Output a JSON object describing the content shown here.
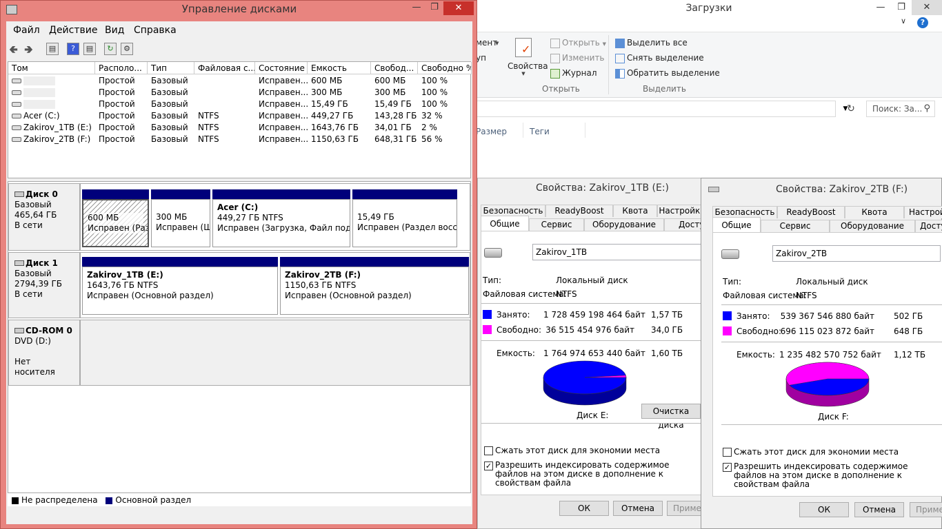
{
  "explorer": {
    "title": "Загрузки",
    "ribbon": {
      "cut1": "мент",
      "cut2": "уп",
      "properties": "Свойства",
      "open": "Открыть",
      "edit": "Изменить",
      "history": "Журнал",
      "group_open": "Открыть",
      "select_all": "Выделить все",
      "deselect": "Снять выделение",
      "invert": "Обратить выделение",
      "group_select": "Выделить"
    },
    "search_placeholder": "Поиск: За...",
    "columns": [
      "Размер",
      "Теги"
    ]
  },
  "dm": {
    "title": "Управление дисками",
    "menu": [
      "Файл",
      "Действие",
      "Вид",
      "Справка"
    ],
    "columns": [
      "Том",
      "Располо...",
      "Тип",
      "Файловая с...",
      "Состояние",
      "Емкость",
      "Свобод...",
      "Свободно %"
    ],
    "rows": [
      [
        "",
        "Простой",
        "Базовый",
        "",
        "Исправен...",
        "600 МБ",
        "600 МБ",
        "100 %"
      ],
      [
        "",
        "Простой",
        "Базовый",
        "",
        "Исправен...",
        "300 МБ",
        "300 МБ",
        "100 %"
      ],
      [
        "",
        "Простой",
        "Базовый",
        "",
        "Исправен...",
        "15,49 ГБ",
        "15,49 ГБ",
        "100 %"
      ],
      [
        "Acer (C:)",
        "Простой",
        "Базовый",
        "NTFS",
        "Исправен...",
        "449,27 ГБ",
        "143,28 ГБ",
        "32 %"
      ],
      [
        "Zakirov_1TB (E:)",
        "Простой",
        "Базовый",
        "NTFS",
        "Исправен...",
        "1643,76 ГБ",
        "34,01 ГБ",
        "2 %"
      ],
      [
        "Zakirov_2TB (F:)",
        "Простой",
        "Базовый",
        "NTFS",
        "Исправен...",
        "1150,63 ГБ",
        "648,31 ГБ",
        "56 %"
      ]
    ],
    "disks": [
      {
        "name": "Диск 0",
        "type": "Базовый",
        "size": "465,64 ГБ",
        "status": "В сети",
        "partitions": [
          {
            "title": "",
            "size": "600 МБ",
            "state": "Исправен (Разд"
          },
          {
            "title": "",
            "size": "300 МБ",
            "state": "Исправен (Ш"
          },
          {
            "title": "Acer  (C:)",
            "size": "449,27 ГБ NTFS",
            "state": "Исправен (Загрузка, Файл подкачи"
          },
          {
            "title": "",
            "size": "15,49 ГБ",
            "state": "Исправен (Раздел восста"
          }
        ]
      },
      {
        "name": "Диск 1",
        "type": "Базовый",
        "size": "2794,39 ГБ",
        "status": "В сети",
        "partitions": [
          {
            "title": "Zakirov_1TB  (E:)",
            "size": "1643,76 ГБ NTFS",
            "state": "Исправен (Основной раздел)"
          },
          {
            "title": "Zakirov_2TB  (F:)",
            "size": "1150,63 ГБ NTFS",
            "state": "Исправен (Основной раздел)"
          }
        ]
      },
      {
        "name": "CD-ROM 0",
        "type": "DVD (D:)",
        "size": "",
        "status": "Нет носителя",
        "partitions": []
      }
    ],
    "legend": [
      "Не распределена",
      "Основной раздел"
    ]
  },
  "dialogs": [
    {
      "title": "Свойства: Zakirov_1TB (E:)",
      "tabs_top": [
        "Безопасность",
        "ReadyBoost",
        "Квота",
        "Настройка"
      ],
      "tabs_bottom": [
        "Общие",
        "Сервис",
        "Оборудование",
        "Доступ"
      ],
      "name": "Zakirov_1TB",
      "type_label": "Тип:",
      "type_value": "Локальный диск",
      "fs_label": "Файловая система:",
      "fs_value": "NTFS",
      "used_label": "Занято:",
      "used_bytes": "1 728 459 198 464 байт",
      "used_h": "1,57 ТБ",
      "free_label": "Свободно:",
      "free_bytes": "36 515 454 976 байт",
      "free_h": "34,0 ГБ",
      "cap_label": "Емкость:",
      "cap_bytes": "1 764 974 653 440 байт",
      "cap_h": "1,60 ТБ",
      "used_fraction": 0.979,
      "disk_label": "Диск E:",
      "cleanup": "Очистка диска",
      "compress": "Сжать этот диск для экономии места",
      "index": "Разрешить индексировать содержимое файлов на этом диске в дополнение к свойствам файла",
      "ok": "ОК",
      "cancel": "Отмена",
      "apply": "Применить"
    },
    {
      "title": "Свойства: Zakirov_2TB (F:)",
      "tabs_top": [
        "Безопасность",
        "ReadyBoost",
        "Квота",
        "Настройка"
      ],
      "tabs_bottom": [
        "Общие",
        "Сервис",
        "Оборудование",
        "Доступ"
      ],
      "name": "Zakirov_2TB",
      "type_label": "Тип:",
      "type_value": "Локальный диск",
      "fs_label": "Файловая система:",
      "fs_value": "NTFS",
      "used_label": "Занято:",
      "used_bytes": "539 367 546 880 байт",
      "used_h": "502 ГБ",
      "free_label": "Свободно:",
      "free_bytes": "696 115 023 872 байт",
      "free_h": "648 ГБ",
      "cap_label": "Емкость:",
      "cap_bytes": "1 235 482 570 752 байт",
      "cap_h": "1,12 ТБ",
      "used_fraction": 0.437,
      "disk_label": "Диск F:",
      "cleanup": "",
      "compress": "Сжать этот диск для экономии места",
      "index": "Разрешить индексировать содержимое файлов на этом диске в дополнение к свойствам файла",
      "ok": "ОК",
      "cancel": "Отмена",
      "apply": "Примен"
    }
  ],
  "colors": {
    "used": "#0000ff",
    "free": "#ff00ff",
    "primary": "#00007b",
    "title_bar": "#e8847f"
  }
}
